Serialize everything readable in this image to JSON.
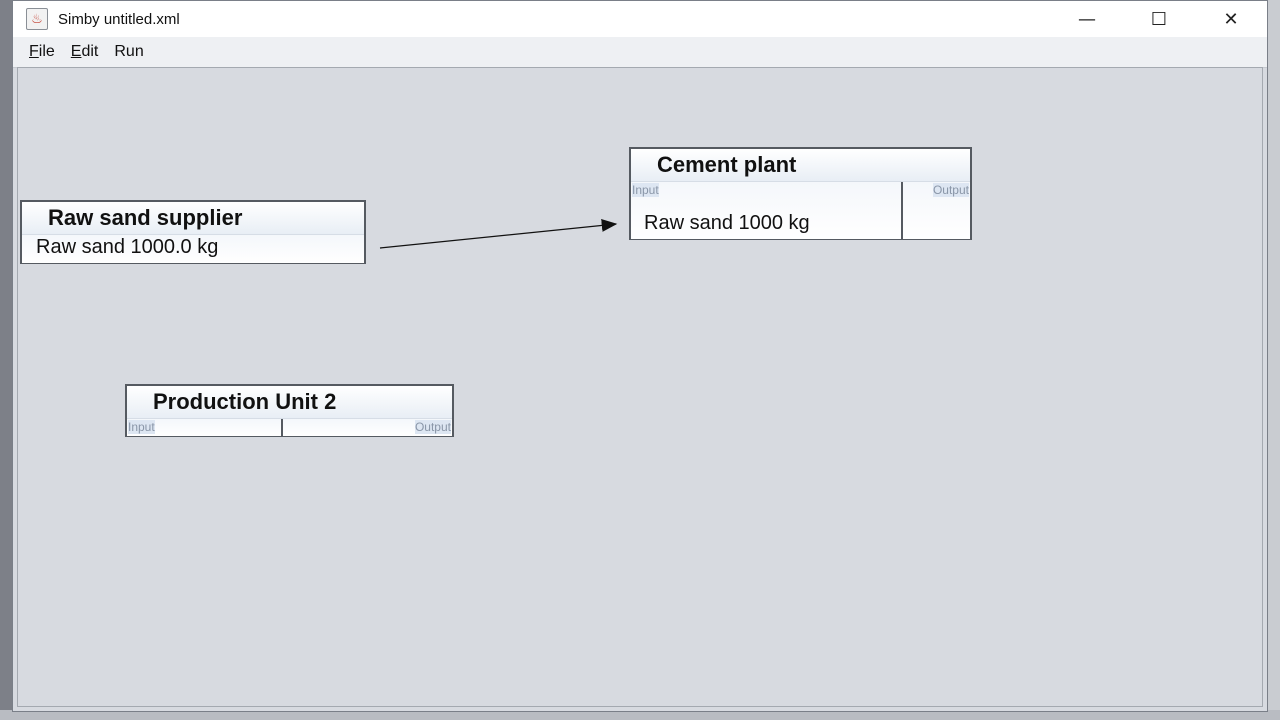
{
  "window": {
    "title": "Simby untitled.xml",
    "icon": "java-cup-icon",
    "controls": {
      "minimize": "—",
      "maximize": "☐",
      "close": "✕"
    }
  },
  "menu": {
    "file": {
      "underline": "F",
      "rest": "ile"
    },
    "edit": {
      "underline": "E",
      "rest": "dit"
    },
    "run": {
      "label": "Run"
    }
  },
  "nodes": {
    "supplier": {
      "title": "Raw sand supplier",
      "item": "Raw sand 1000.0 kg"
    },
    "cement": {
      "title": "Cement plant",
      "input_label": "Input",
      "output_label": "Output",
      "item": "Raw sand 1000 kg"
    },
    "unit2": {
      "title": "Production Unit 2",
      "input_label": "Input",
      "output_label": "Output"
    }
  },
  "connections": [
    {
      "from": "Raw sand supplier",
      "to": "Cement plant"
    }
  ]
}
